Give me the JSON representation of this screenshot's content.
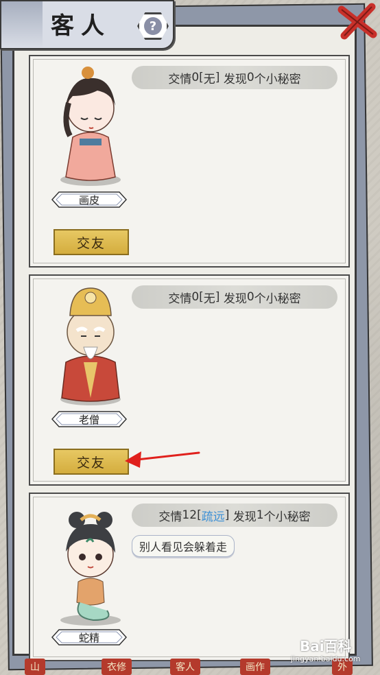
{
  "header": {
    "title": "客人"
  },
  "guests": [
    {
      "name": "画皮",
      "affection": "0",
      "relation": "无",
      "secrets": "0",
      "secret_text": "",
      "action_label": "交友"
    },
    {
      "name": "老僧",
      "affection": "0",
      "relation": "无",
      "secrets": "0",
      "secret_text": "",
      "action_label": "交友"
    },
    {
      "name": "蛇精",
      "affection": "12",
      "relation": "疏远",
      "secrets": "1",
      "secret_text": "别人看见会躲着走",
      "action_label": ""
    }
  ],
  "labels": {
    "affection_prefix": "交情",
    "found_prefix": "发现",
    "secret_suffix": "个小秘密"
  },
  "bottom_tabs": [
    "山",
    "衣修",
    "客人",
    "画作",
    "外"
  ],
  "watermark": {
    "logo": "Bai百科",
    "url": "jingyan.baidu.com"
  },
  "colors": {
    "accent_gold": "#d4ad3e",
    "relation_far": "#3a8fd6",
    "tab_red": "#b43a2c"
  }
}
